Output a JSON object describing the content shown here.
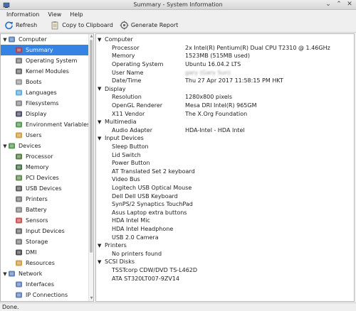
{
  "window": {
    "title": "Summary - System Information"
  },
  "menu": [
    "Information",
    "View",
    "Help"
  ],
  "toolbar": {
    "refresh": "Refresh",
    "copy": "Copy to Clipboard",
    "report": "Generate Report"
  },
  "sidebar": {
    "computer": {
      "label": "Computer",
      "items": [
        "Summary",
        "Operating System",
        "Kernel Modules",
        "Boots",
        "Languages",
        "Filesystems",
        "Display",
        "Environment Variables",
        "Users"
      ]
    },
    "devices": {
      "label": "Devices",
      "items": [
        "Processor",
        "Memory",
        "PCI Devices",
        "USB Devices",
        "Printers",
        "Battery",
        "Sensors",
        "Input Devices",
        "Storage",
        "DMI",
        "Resources"
      ]
    },
    "network": {
      "label": "Network",
      "items": [
        "Interfaces",
        "IP Connections"
      ]
    }
  },
  "info": {
    "computer": {
      "title": "Computer",
      "rows": [
        {
          "k": "Processor",
          "v": "2x Intel(R) Pentium(R) Dual  CPU  T2310  @ 1.46GHz"
        },
        {
          "k": "Memory",
          "v": "1523MB (515MB used)"
        },
        {
          "k": "Operating System",
          "v": "Ubuntu 16.04.2 LTS"
        },
        {
          "k": "User Name",
          "v": "gary (Gary Sun)"
        },
        {
          "k": "Date/Time",
          "v": "Thu 27 Apr 2017 11:58:15 PM HKT"
        }
      ]
    },
    "display": {
      "title": "Display",
      "rows": [
        {
          "k": "Resolution",
          "v": "1280x800 pixels"
        },
        {
          "k": "OpenGL Renderer",
          "v": "Mesa DRI Intel(R) 965GM"
        },
        {
          "k": "X11 Vendor",
          "v": "The X.Org Foundation"
        }
      ]
    },
    "multimedia": {
      "title": "Multimedia",
      "rows": [
        {
          "k": "Audio Adapter",
          "v": "HDA-Intel - HDA Intel"
        }
      ]
    },
    "input": {
      "title": "Input Devices",
      "items": [
        "Sleep Button",
        "Lid Switch",
        "Power Button",
        "AT Translated Set 2 keyboard",
        "Video Bus",
        "Logitech USB Optical Mouse",
        "Dell Dell USB Keyboard",
        "SynPS/2 Synaptics TouchPad",
        "Asus Laptop extra buttons",
        "HDA Intel Mic",
        "HDA Intel Headphone",
        "USB 2.0 Camera"
      ]
    },
    "printers": {
      "title": "Printers",
      "items": [
        "No printers found"
      ]
    },
    "scsi": {
      "title": "SCSI Disks",
      "items": [
        "TSSTcorp CDW/DVD TS-L462D",
        "ATA ST320LT007-9ZV14"
      ]
    }
  },
  "status": "Done."
}
